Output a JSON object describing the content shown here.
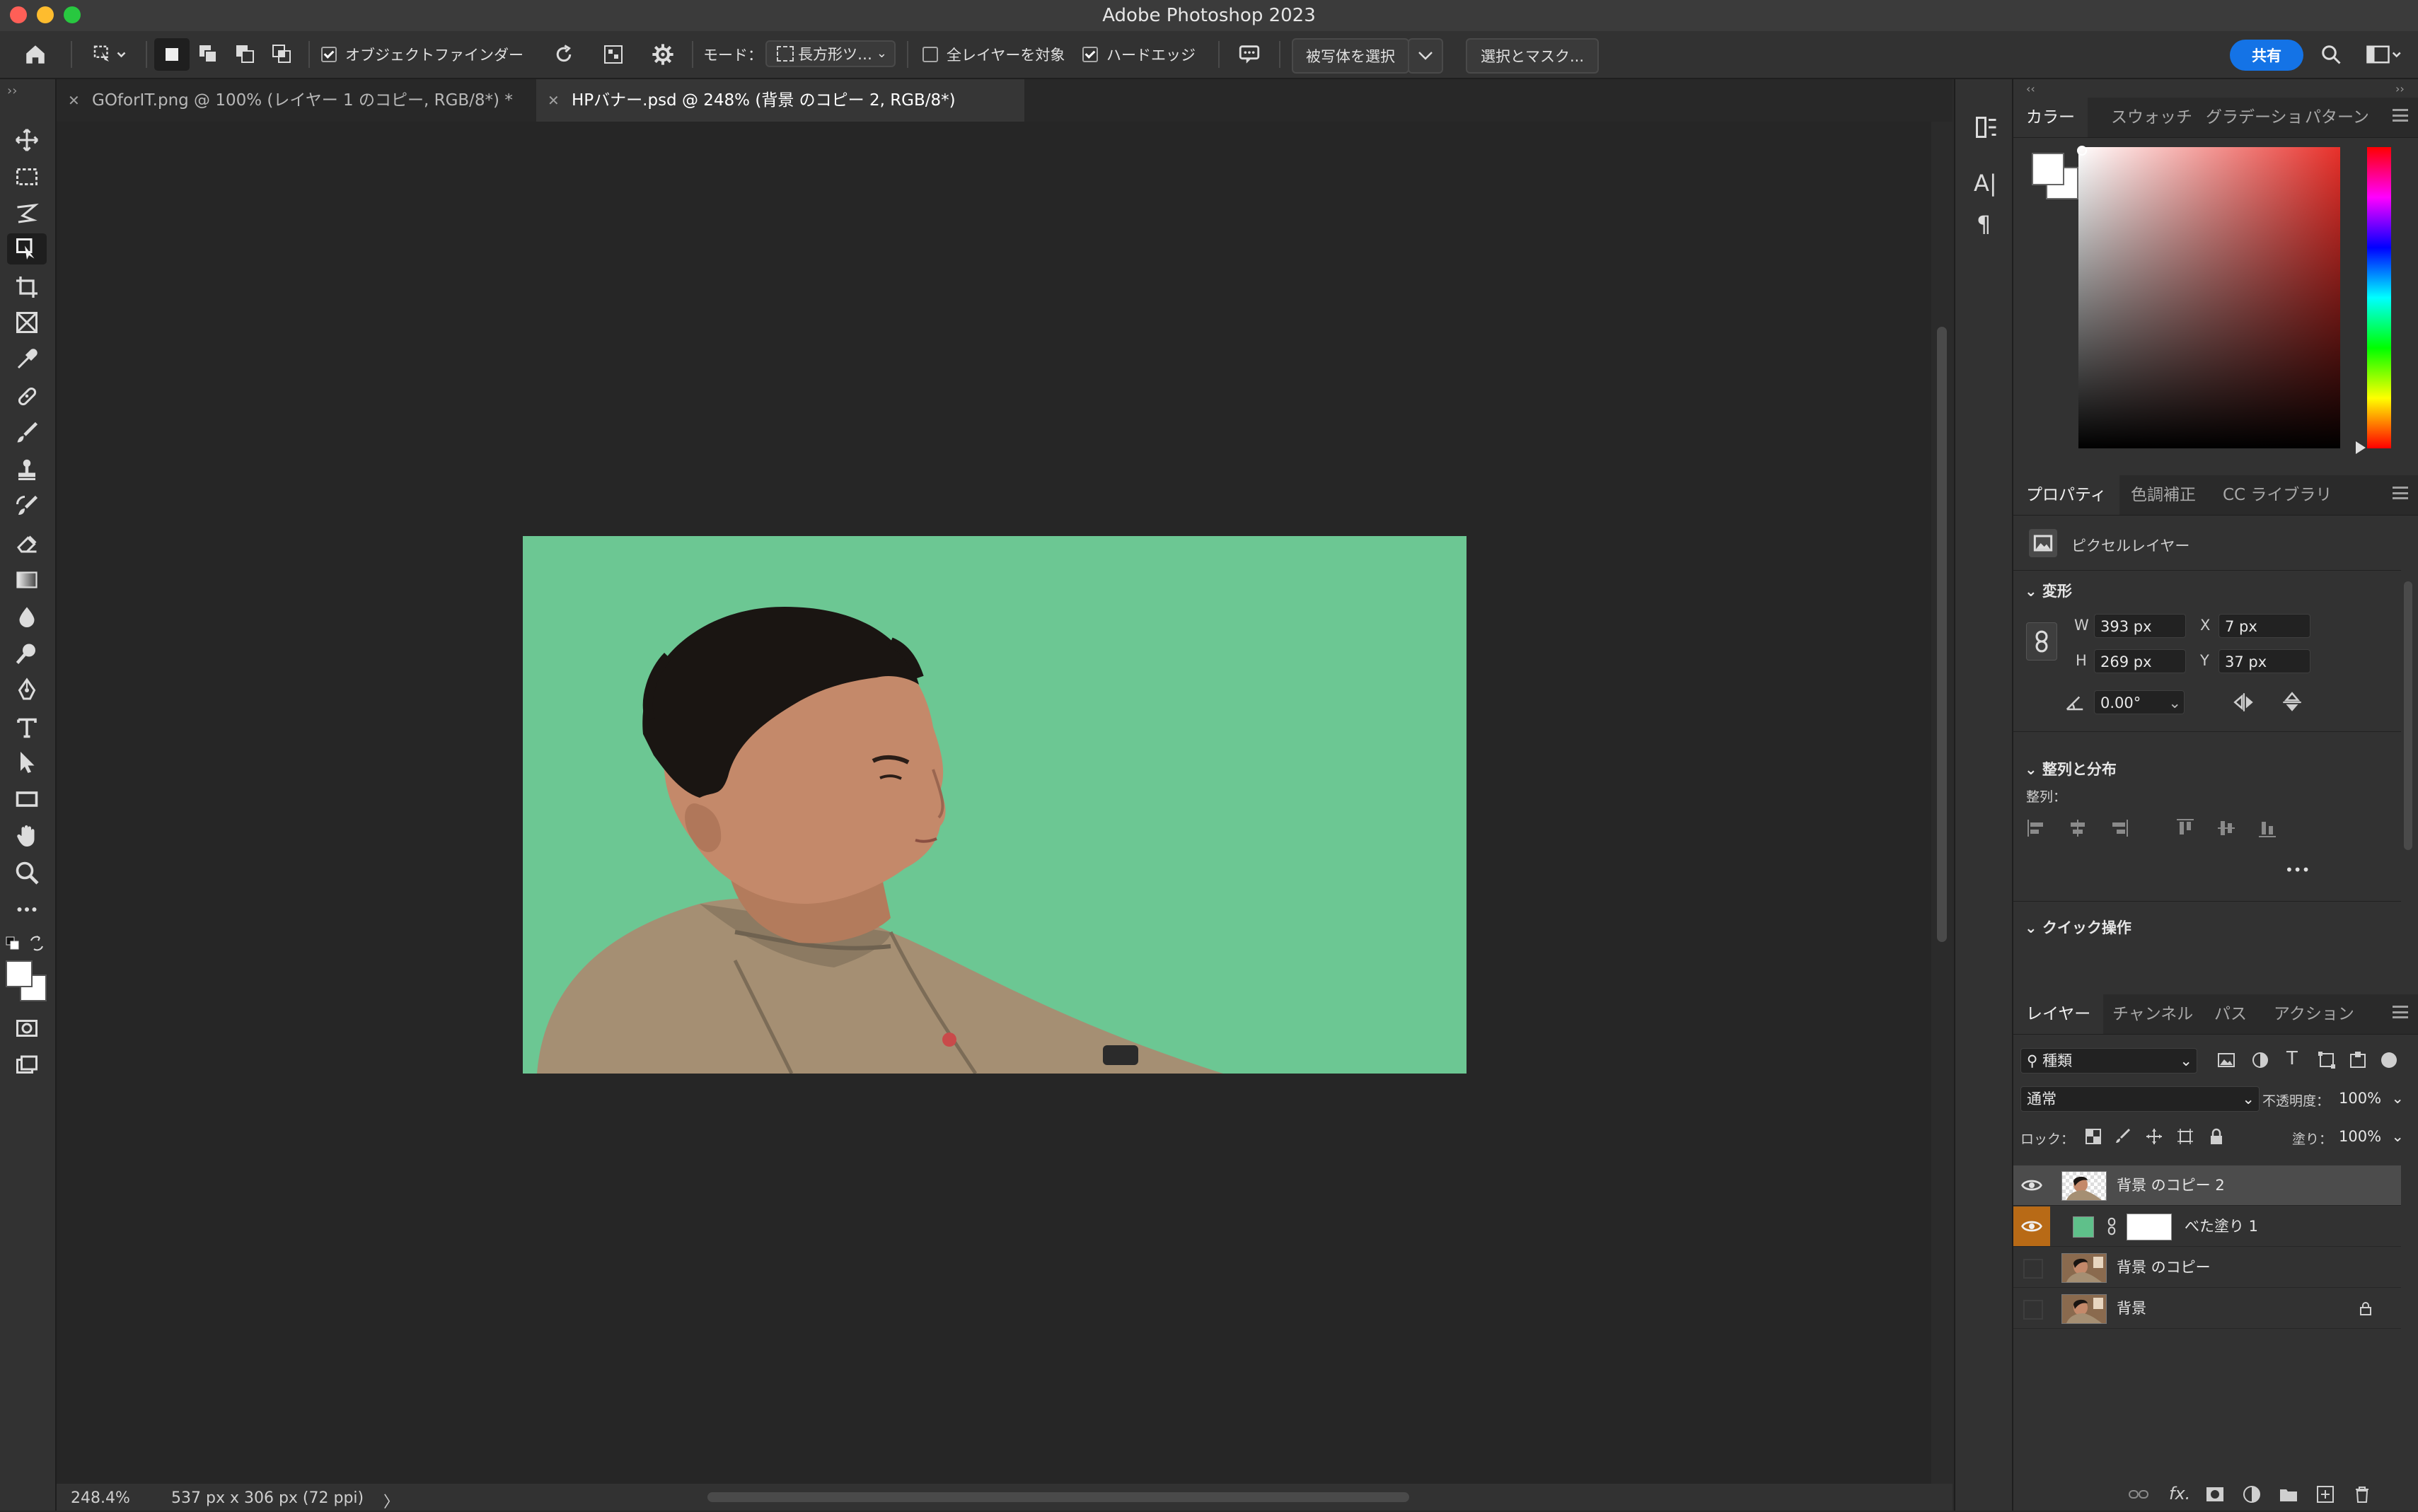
{
  "app": {
    "title": "Adobe Photoshop 2023"
  },
  "options_bar": {
    "object_finder_label": "オブジェクトファインダー",
    "object_finder_checked": true,
    "mode_label": "モード：",
    "mode_value": "長方形ツ…",
    "all_layers_label": "全レイヤーを対象",
    "all_layers_checked": false,
    "hard_edge_label": "ハードエッジ",
    "hard_edge_checked": true,
    "select_subject_label": "被写体を選択",
    "select_mask_label": "選択とマスク...",
    "share_label": "共有"
  },
  "tabs": [
    {
      "label": "GOforIT.png @ 100% (レイヤー 1 のコピー, RGB/8*) *",
      "active": false
    },
    {
      "label": "HPバナー.psd @ 248% (背景 のコピー 2, RGB/8*)",
      "active": true
    }
  ],
  "status": {
    "zoom": "248.4%",
    "doc_info": "537 px x 306 px (72 ppi)",
    "arrow": "〉"
  },
  "color_panel": {
    "tabs": [
      "カラー",
      "スウォッチ",
      "グラデーショ",
      "パターン"
    ],
    "active_tab": 0,
    "foreground": "#ffffff",
    "background": "#ffffff",
    "hue": "#e8302a"
  },
  "properties_panel": {
    "tabs": [
      "プロパティ",
      "色調補正",
      "CC ライブラリ"
    ],
    "active_tab": 0,
    "layer_type": "ピクセルレイヤー",
    "transform_heading": "変形",
    "w_label": "W",
    "w_value": "393 px",
    "h_label": "H",
    "h_value": "269 px",
    "x_label": "X",
    "x_value": "7 px",
    "y_label": "Y",
    "y_value": "37 px",
    "angle_value": "0.00°",
    "align_heading": "整列と分布",
    "align_label": "整列：",
    "more": "•••",
    "quick_actions_heading": "クイック操作"
  },
  "layers_panel": {
    "tabs": [
      "レイヤー",
      "チャンネル",
      "パス",
      "アクション"
    ],
    "active_tab": 0,
    "filter_label": "種類",
    "blend_mode": "通常",
    "opacity_label": "不透明度：",
    "opacity_value": "100%",
    "lock_label": "ロック：",
    "fill_label": "塗り：",
    "fill_value": "100%",
    "layers": [
      {
        "name": "背景 のコピー 2",
        "visible": true,
        "selected": true
      },
      {
        "name": "べた塗り 1",
        "visible": true,
        "selected": false,
        "fill_color": "#5fc08a"
      },
      {
        "name": "背景 のコピー",
        "visible": false,
        "selected": false
      },
      {
        "name": "背景",
        "visible": false,
        "selected": false,
        "locked": true
      }
    ],
    "footer_fx": "fx."
  },
  "canvas": {
    "fill_color": "#6cc793"
  },
  "colors": {
    "accent": "#1473e6",
    "fill_swatch": "#5fc08a",
    "orange_eye_bg": "#b86a16"
  }
}
